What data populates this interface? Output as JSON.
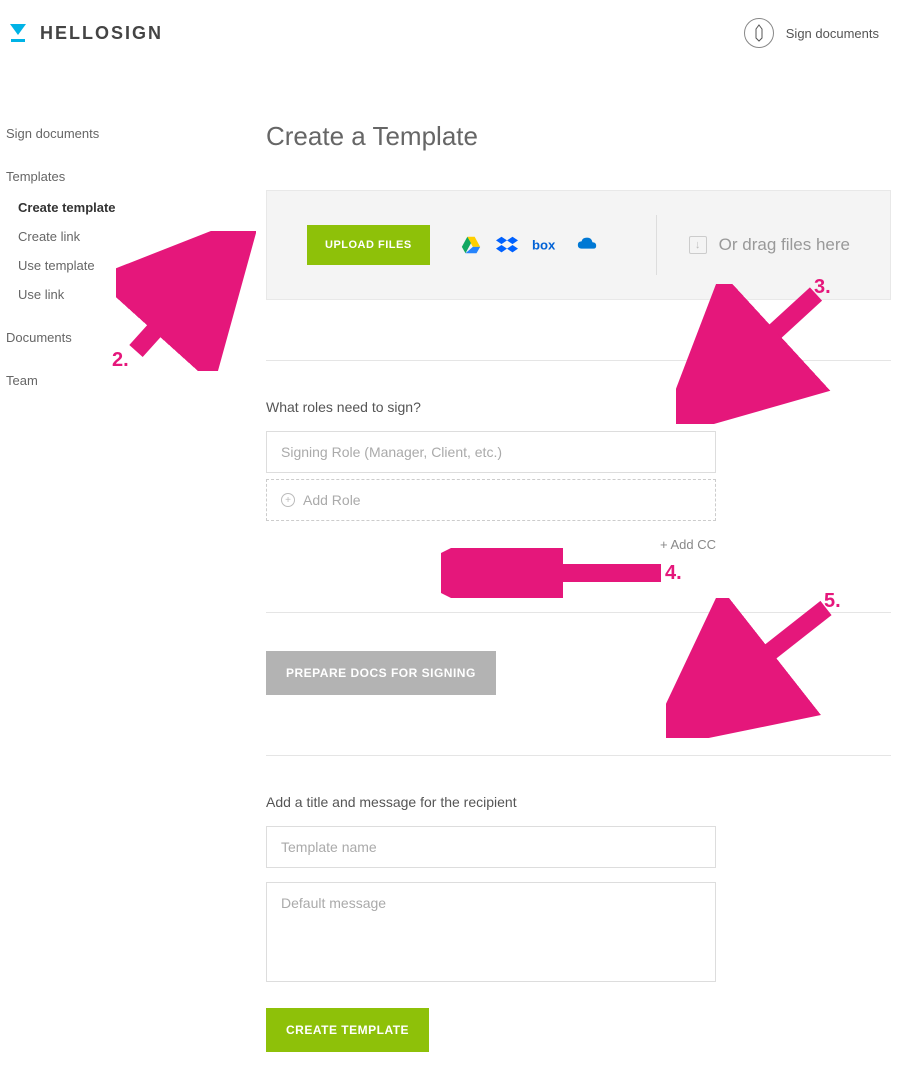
{
  "header": {
    "brand_text": "HELLOSIGN",
    "sign_link": "Sign documents"
  },
  "sidebar": {
    "items": [
      {
        "label": "Sign documents",
        "children": []
      },
      {
        "label": "Templates",
        "children": [
          {
            "label": "Create template",
            "active": true
          },
          {
            "label": "Create link",
            "active": false
          },
          {
            "label": "Use template",
            "active": false
          },
          {
            "label": "Use link",
            "active": false
          }
        ]
      },
      {
        "label": "Documents",
        "children": []
      },
      {
        "label": "Team",
        "children": []
      }
    ]
  },
  "page": {
    "title": "Create a Template",
    "upload_button": "UPLOAD FILES",
    "drag_hint": "Or drag files here",
    "roles": {
      "heading": "What roles need to sign?",
      "role_placeholder": "Signing Role (Manager, Client, etc.)",
      "add_role": "Add Role",
      "add_cc": "+ Add CC"
    },
    "prepare_button": "PREPARE DOCS FOR SIGNING",
    "titlemsg": {
      "heading": "Add a title and message for the recipient",
      "name_placeholder": "Template name",
      "msg_placeholder": "Default message"
    },
    "create_button": "CREATE TEMPLATE"
  },
  "annotations": {
    "n2": "2.",
    "n3": "3.",
    "n4": "4.",
    "n5": "5."
  }
}
